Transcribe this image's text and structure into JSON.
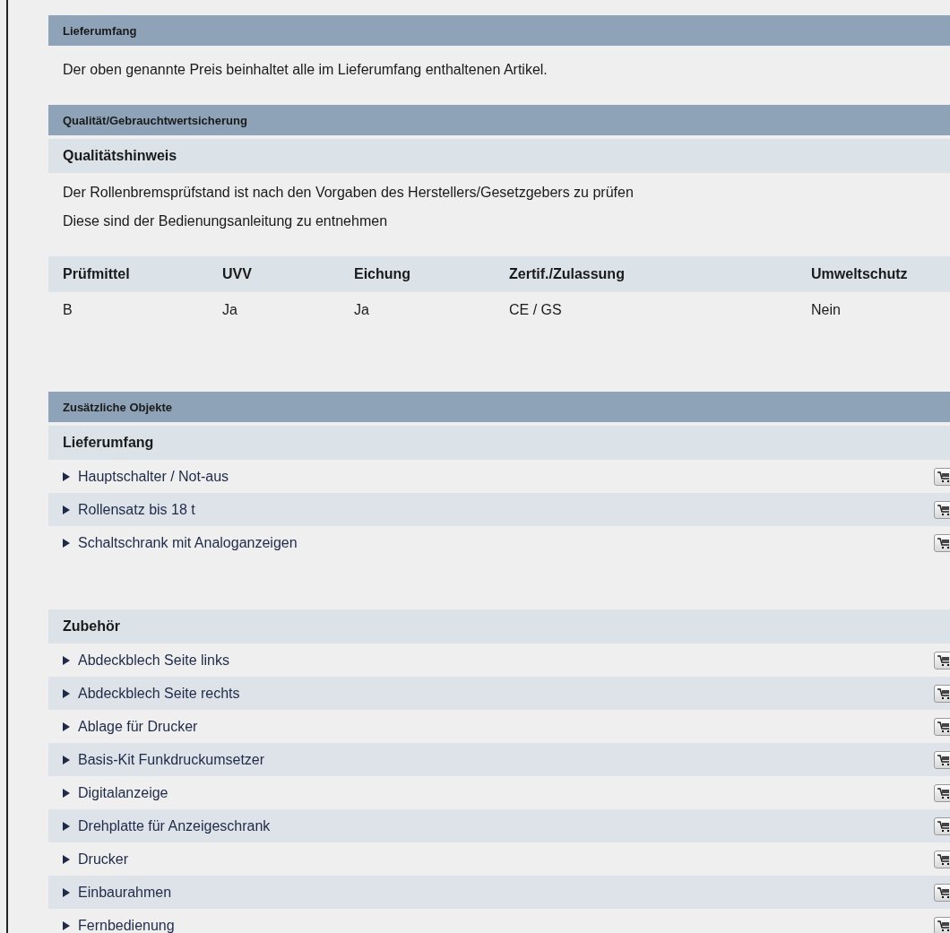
{
  "sections": [
    {
      "kind": "delivery",
      "title": "Lieferumfang",
      "text": "Der oben genannte Preis beinhaltet alle im Lieferumfang enthaltenen Artikel."
    },
    {
      "kind": "quality",
      "title": "Qualität/Gebrauchtwertsicherung",
      "subtitle": "Qualitätshinweis",
      "lines": [
        "Der Rollenbremsprüfstand ist nach den Vorgaben des Herstellers/Gesetzgebers zu prüfen",
        "Diese sind der Bedienungsanleitung zu entnehmen"
      ],
      "table": {
        "columns": [
          "Prüfmittel",
          "UVV",
          "Eichung",
          "Zertif./Zulassung",
          "Umweltschutz"
        ],
        "rows": [
          [
            "B",
            "Ja",
            "Ja",
            "CE / GS",
            "Nein"
          ]
        ]
      }
    },
    {
      "kind": "objects",
      "title": "Zusätzliche Objekte",
      "groups": [
        {
          "title": "Lieferumfang",
          "items": [
            "Hauptschalter / Not-aus",
            "Rollensatz bis 18 t",
            "Schaltschrank mit Analoganzeigen"
          ]
        },
        {
          "title": "Zubehör",
          "items": [
            "Abdeckblech Seite links",
            "Abdeckblech Seite rechts",
            "Ablage für Drucker",
            "Basis-Kit Funkdruckumsetzer",
            "Digitalanzeige",
            "Drehplatte für Anzeigeschrank",
            "Drucker",
            "Einbaurahmen",
            "Fernbedienung"
          ]
        }
      ]
    }
  ]
}
